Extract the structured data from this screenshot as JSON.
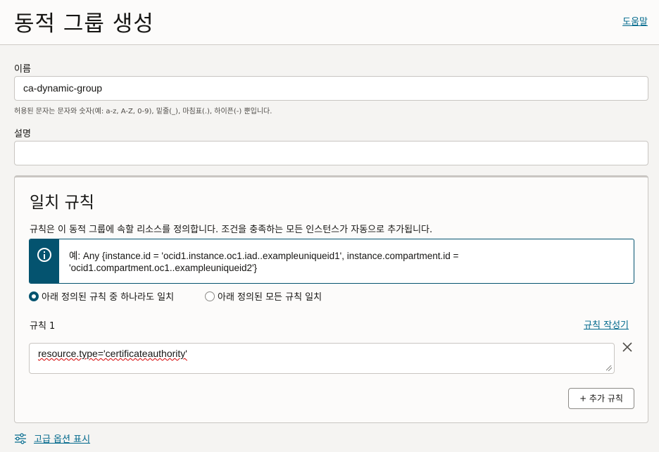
{
  "header": {
    "title": "동적 그룹 생성",
    "help_link": "도움말"
  },
  "form": {
    "name_label": "이름",
    "name_value": "ca-dynamic-group",
    "name_hint": "허용된 문자는 문자와 숫자(예: a-z, A-Z, 0-9), 밑줄(_), 마침표(.), 하이픈(-) 뿐입니다.",
    "description_label": "설명",
    "description_value": ""
  },
  "matching_rules": {
    "title": "일치 규칙",
    "description": "규칙은 이 동적 그룹에 속할 리소스를 정의합니다. 조건을 충족하는 모든 인스턴스가 자동으로 추가됩니다.",
    "info_text": "예: Any {instance.id = 'ocid1.instance.oc1.iad..exampleuniqueid1', instance.compartment.id = 'ocid1.compartment.oc1..exampleuniqueid2'}",
    "options": [
      {
        "label": "아래 정의된 규칙 중 하나라도 일치",
        "selected": true
      },
      {
        "label": "아래 정의된 모든 규칙 일치",
        "selected": false
      }
    ],
    "rule_label": "규칙 1",
    "rule_builder_link": "규칙 작성기",
    "rule_value": "resource.type='certificateauthority'",
    "add_rule_button": "+ 추가 규칙"
  },
  "advanced": {
    "label": "고급 옵션 표시"
  },
  "icons": {
    "info": "info-icon",
    "remove": "close-icon",
    "advanced": "sliders-icon"
  },
  "colors": {
    "accent": "#04536f",
    "link": "#00688c"
  }
}
